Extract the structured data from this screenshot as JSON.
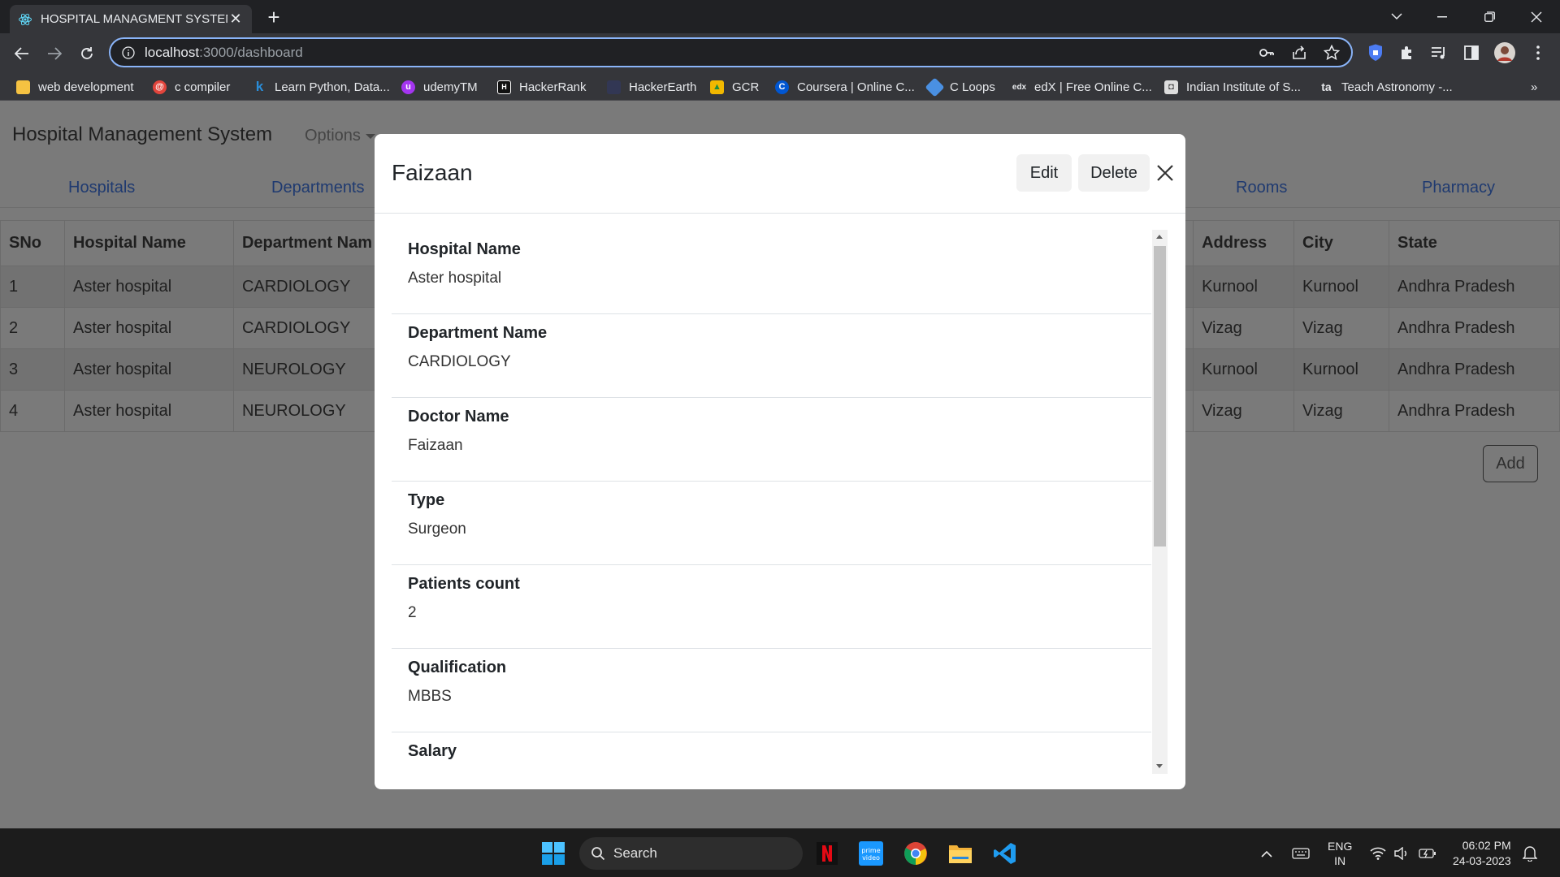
{
  "browser": {
    "tab_title": "HOSPITAL MANAGMENT SYSTEM",
    "url_host": "localhost",
    "url_path": ":3000/dashboard",
    "bookmarks": [
      {
        "label": "web development",
        "color": "#f5c242"
      },
      {
        "label": "c compiler",
        "color": "#e2453c"
      },
      {
        "label": "Learn Python, Data...",
        "color": "#2a8dd8"
      },
      {
        "label": "udemyTM",
        "color": "#a435f0"
      },
      {
        "label": "HackerRank",
        "color": "#111111"
      },
      {
        "label": "HackerEarth",
        "color": "#323754"
      },
      {
        "label": "GCR",
        "color": "#f1b800"
      },
      {
        "label": "Coursera | Online C...",
        "color": "#0056d2"
      },
      {
        "label": "C Loops",
        "color": "#4a90e2"
      },
      {
        "label": "edX | Free Online C...",
        "color": "#2b2b2b"
      },
      {
        "label": "Indian Institute of S...",
        "color": "#dddddd"
      },
      {
        "label": "Teach Astronomy -...",
        "color": "#1a1a1a"
      }
    ],
    "more_bookmarks": "»"
  },
  "app": {
    "brand": "Hospital Management System",
    "options_label": "Options",
    "nav": [
      "Hospitals",
      "Departments",
      "Rooms",
      "Pharmacy"
    ],
    "add_label": "Add"
  },
  "table": {
    "headers": [
      "SNo",
      "Hospital Name",
      "Department Nam",
      "Address",
      "City",
      "State"
    ],
    "rows": [
      [
        "1",
        "Aster hospital",
        "CARDIOLOGY",
        "Kurnool",
        "Kurnool",
        "Andhra Pradesh"
      ],
      [
        "2",
        "Aster hospital",
        "CARDIOLOGY",
        "Vizag",
        "Vizag",
        "Andhra Pradesh"
      ],
      [
        "3",
        "Aster hospital",
        "NEUROLOGY",
        "Kurnool",
        "Kurnool",
        "Andhra Pradesh"
      ],
      [
        "4",
        "Aster hospital",
        "NEUROLOGY",
        "Vizag",
        "Vizag",
        "Andhra Pradesh"
      ]
    ]
  },
  "modal": {
    "title": "Faizaan",
    "edit_label": "Edit",
    "delete_label": "Delete",
    "fields": [
      {
        "label": "Hospital Name",
        "value": "Aster hospital"
      },
      {
        "label": "Department Name",
        "value": "CARDIOLOGY"
      },
      {
        "label": "Doctor Name",
        "value": "Faizaan"
      },
      {
        "label": "Type",
        "value": "Surgeon"
      },
      {
        "label": "Patients count",
        "value": "2"
      },
      {
        "label": "Qualification",
        "value": "MBBS"
      },
      {
        "label": "Salary",
        "value": ""
      }
    ]
  },
  "taskbar": {
    "search_label": "Search",
    "lang_top": "ENG",
    "lang_bottom": "IN",
    "time": "06:02 PM",
    "date": "24-03-2023"
  },
  "colors": {
    "accent": "#8ab4f8",
    "overlay": "#7a7a7a",
    "link": "#1f3a70"
  }
}
